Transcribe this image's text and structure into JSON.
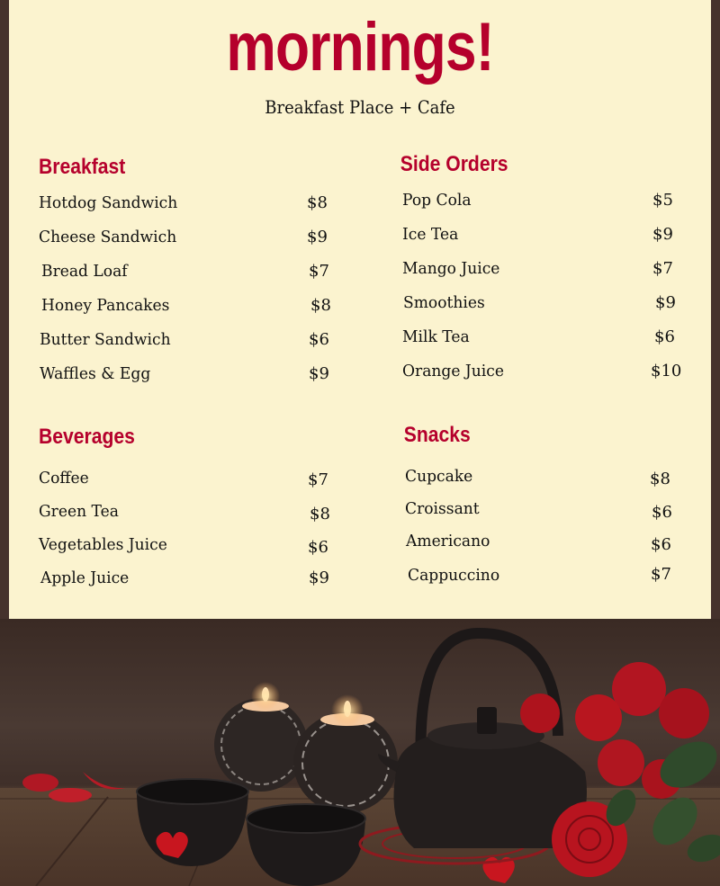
{
  "header": {
    "title": "mornings!",
    "subtitle": "Breakfast Place + Cafe"
  },
  "colors": {
    "accent": "#b5002c",
    "panel": "#fbf3cf",
    "background": "#45322c",
    "text": "#111111"
  },
  "sections": {
    "breakfast": {
      "title": "Breakfast",
      "items": [
        {
          "name": "Hotdog Sandwich",
          "price": "$8"
        },
        {
          "name": "Cheese Sandwich",
          "price": "$9"
        },
        {
          "name": "Bread Loaf",
          "price": "$7"
        },
        {
          "name": "Honey Pancakes",
          "price": "$8"
        },
        {
          "name": "Butter Sandwich",
          "price": "$6"
        },
        {
          "name": "Waffles & Egg",
          "price": "$9"
        }
      ]
    },
    "side_orders": {
      "title": "Side Orders",
      "items": [
        {
          "name": "Pop Cola",
          "price": "$5"
        },
        {
          "name": "Ice Tea",
          "price": "$9"
        },
        {
          "name": "Mango Juice",
          "price": "$7"
        },
        {
          "name": "Smoothies",
          "price": "$9"
        },
        {
          "name": "Milk Tea",
          "price": "$6"
        },
        {
          "name": "Orange Juice",
          "price": "$10"
        }
      ]
    },
    "beverages": {
      "title": "Beverages",
      "items": [
        {
          "name": "Coffee",
          "price": "$7"
        },
        {
          "name": "Green Tea",
          "price": "$8"
        },
        {
          "name": "Vegetables Juice",
          "price": "$6"
        },
        {
          "name": "Apple Juice",
          "price": "$9"
        }
      ]
    },
    "snacks": {
      "title": "Snacks",
      "items": [
        {
          "name": "Cupcake",
          "price": "$8"
        },
        {
          "name": "Croissant",
          "price": "$6"
        },
        {
          "name": "Americano",
          "price": "$6"
        },
        {
          "name": "Cappuccino",
          "price": "$7"
        }
      ]
    }
  },
  "photo": {
    "description": "Cast iron teapot with cups, candles and red roses on wooden table"
  }
}
